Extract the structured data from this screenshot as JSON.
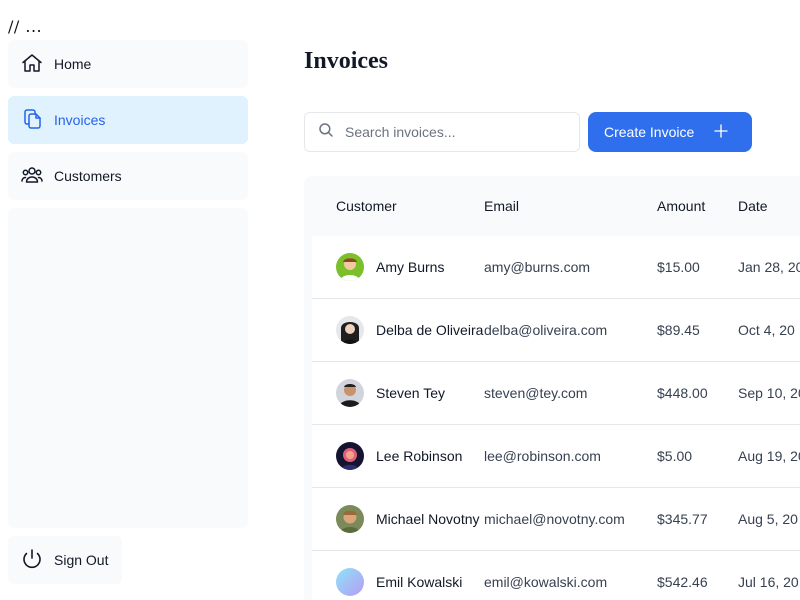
{
  "breadcrumb": "// ...",
  "sidebar": {
    "items": [
      {
        "label": "Home",
        "icon": "home-icon"
      },
      {
        "label": "Invoices",
        "icon": "document-duplicate-icon",
        "active": true
      },
      {
        "label": "Customers",
        "icon": "user-group-icon"
      }
    ],
    "signout_label": "Sign Out"
  },
  "page": {
    "title": "Invoices"
  },
  "search": {
    "placeholder": "Search invoices...",
    "value": ""
  },
  "create_button": {
    "label": "Create Invoice"
  },
  "table": {
    "columns": [
      "Customer",
      "Email",
      "Amount",
      "Date"
    ],
    "rows": [
      {
        "name": "Amy Burns",
        "email": "amy@burns.com",
        "amount": "$15.00",
        "date": "Jan 28, 20"
      },
      {
        "name": "Delba de Oliveira",
        "email": "delba@oliveira.com",
        "amount": "$89.45",
        "date": "Oct 4, 20"
      },
      {
        "name": "Steven Tey",
        "email": "steven@tey.com",
        "amount": "$448.00",
        "date": "Sep 10, 20"
      },
      {
        "name": "Lee Robinson",
        "email": "lee@robinson.com",
        "amount": "$5.00",
        "date": "Aug 19, 20"
      },
      {
        "name": "Michael Novotny",
        "email": "michael@novotny.com",
        "amount": "$345.77",
        "date": "Aug 5, 20"
      },
      {
        "name": "Emil Kowalski",
        "email": "emil@kowalski.com",
        "amount": "$542.46",
        "date": "Jul 16, 20"
      }
    ]
  },
  "colors": {
    "accent": "#2f6fed",
    "active_nav_bg": "#e0f2fe",
    "active_nav_text": "#2563eb",
    "panel_bg": "#f9fafb"
  }
}
